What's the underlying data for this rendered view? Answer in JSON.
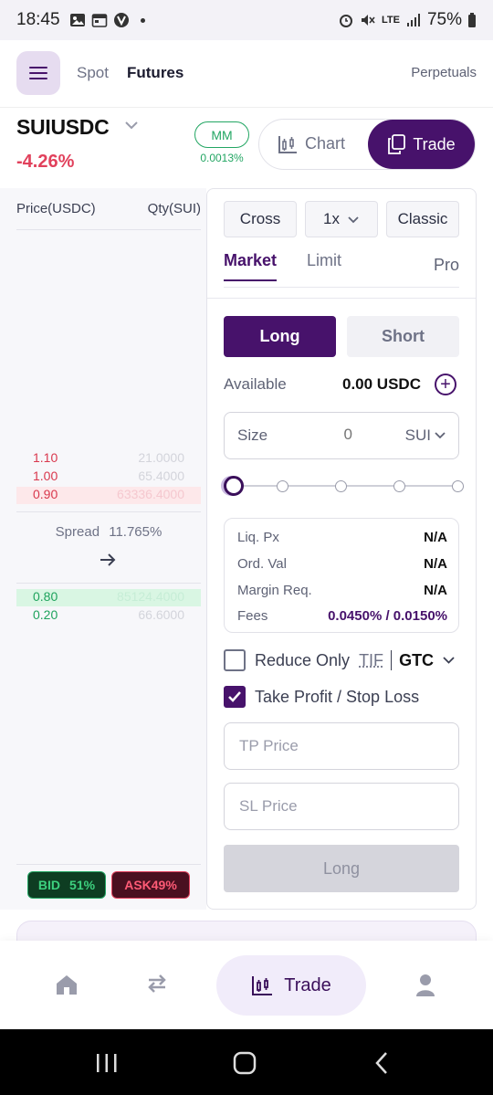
{
  "status_bar": {
    "time": "18:45",
    "network": "LTE",
    "battery": "75%"
  },
  "header": {
    "menu_icon": "hamburger-menu-icon",
    "tabs": [
      {
        "label": "Spot",
        "active": false
      },
      {
        "label": "Futures",
        "active": true
      }
    ],
    "right_link": "Perpetuals"
  },
  "market": {
    "pair": "SUIUSDC",
    "change": "-4.26%",
    "mm_label": "MM",
    "mm_value": "0.0013%",
    "view_toggle": {
      "chart": "Chart",
      "trade": "Trade",
      "active": "Trade"
    }
  },
  "order_book": {
    "headers": {
      "price": "Price(USDC)",
      "qty": "Qty(SUI)"
    },
    "asks": [
      {
        "price": "1.10",
        "qty": "21.0000"
      },
      {
        "price": "1.00",
        "qty": "65.4000"
      },
      {
        "price": "0.90",
        "qty": "63336.4000"
      }
    ],
    "spread_label": "Spread",
    "spread_value": "11.765%",
    "bids": [
      {
        "price": "0.80",
        "qty": "85124.4000"
      },
      {
        "price": "0.20",
        "qty": "66.6000"
      }
    ],
    "bid_label": "BID",
    "bid_pct": "51%",
    "ask_label": "ASK49%"
  },
  "trade_panel": {
    "margin_mode": "Cross",
    "leverage": "1x",
    "layout": "Classic",
    "order_tabs": [
      "Market",
      "Limit"
    ],
    "active_order_tab": "Market",
    "pro_label": "Pro",
    "side_long": "Long",
    "side_short": "Short",
    "available_label": "Available",
    "available_value": "0.00 USDC",
    "size_label": "Size",
    "size_value": "0",
    "size_unit": "SUI",
    "slider_position": 0,
    "info": {
      "liq_label": "Liq. Px",
      "liq_value": "N/A",
      "ord_label": "Ord. Val",
      "ord_value": "N/A",
      "margin_label": "Margin Req.",
      "margin_value": "N/A",
      "fees_label": "Fees",
      "fees_value": "0.0450% / 0.0150%"
    },
    "reduce_only_label": "Reduce Only",
    "reduce_only_checked": false,
    "tif_label": "TIF",
    "tif_value": "GTC",
    "tpsl_label": "Take Profit / Stop Loss",
    "tpsl_checked": true,
    "tp_placeholder": "TP Price",
    "sl_placeholder": "SL Price",
    "submit_label": "Long"
  },
  "bottom_nav": {
    "items": [
      "home-icon",
      "swap-icon",
      "Trade",
      "profile-icon"
    ],
    "active_label": "Trade"
  },
  "colors": {
    "brand": "#47126b",
    "positive": "#23a663",
    "negative": "#e1415c"
  }
}
